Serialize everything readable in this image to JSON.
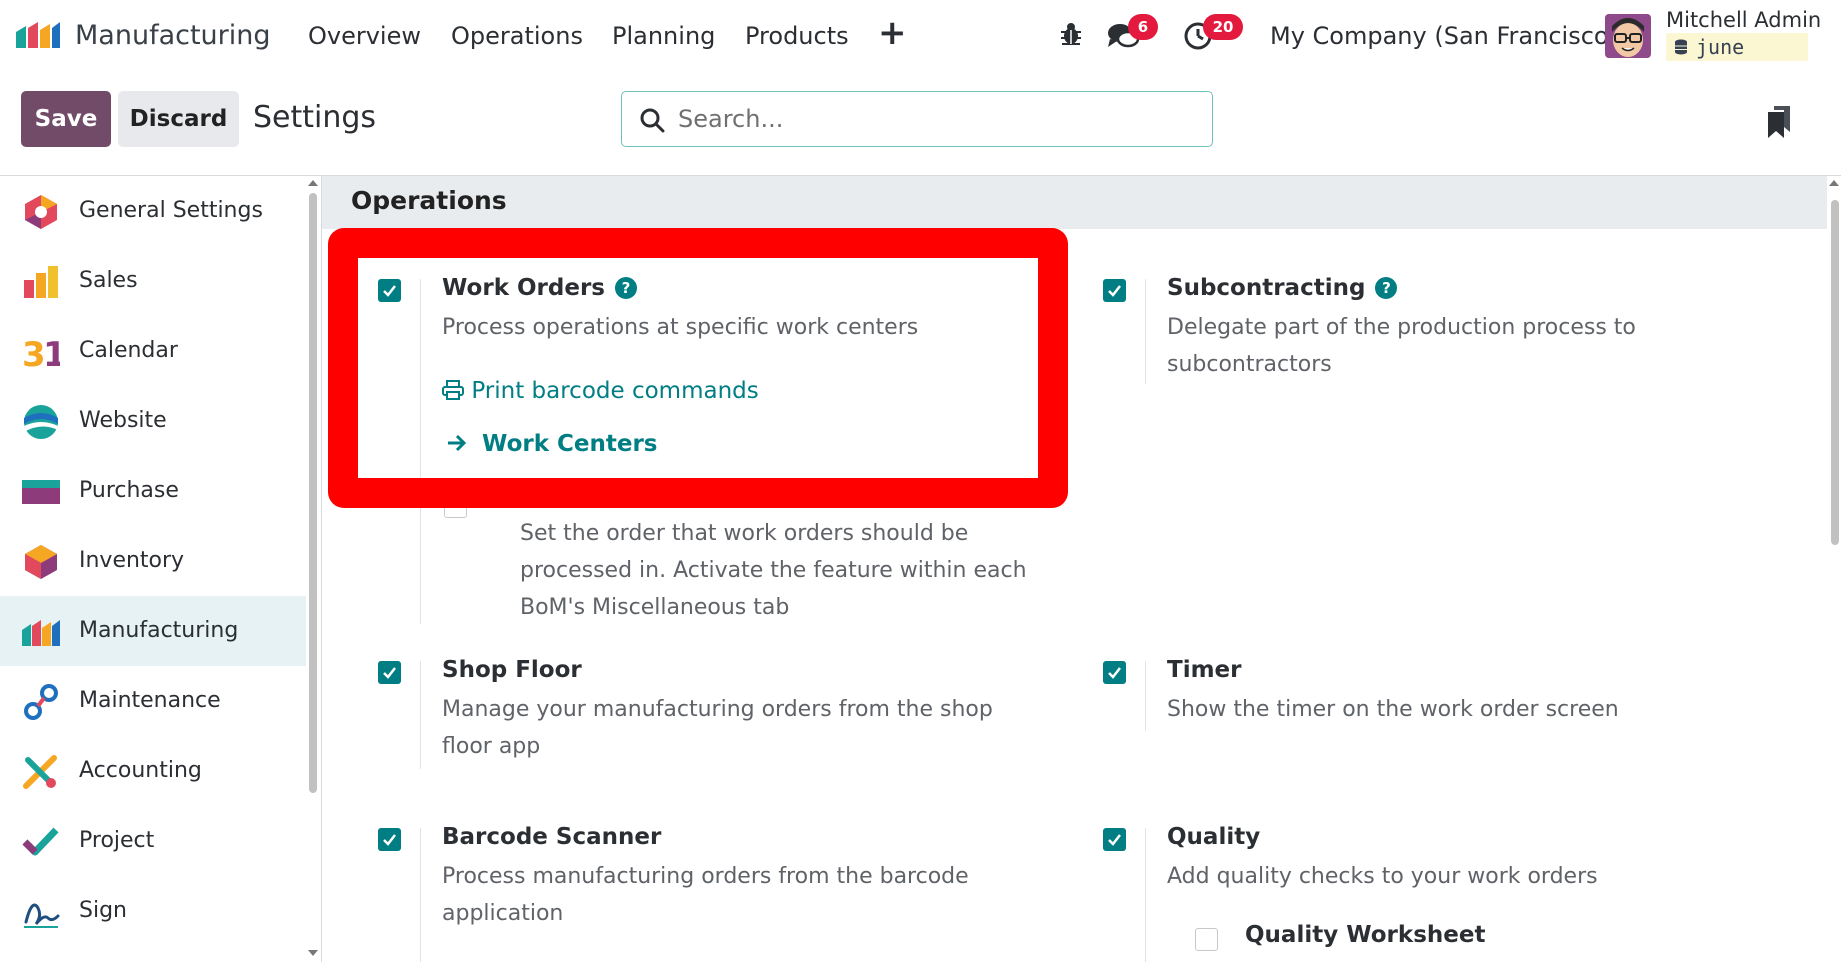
{
  "navbar": {
    "app_name": "Manufacturing",
    "menu": [
      "Overview",
      "Operations",
      "Planning",
      "Products"
    ],
    "messages_count": "6",
    "activities_count": "20",
    "company": "My Company (San Francisco)",
    "user_name": "Mitchell Admin",
    "database": "june"
  },
  "control": {
    "save_label": "Save",
    "discard_label": "Discard",
    "title": "Settings",
    "search_placeholder": "Search..."
  },
  "sidebar": {
    "items": [
      {
        "label": "General Settings",
        "icon": "general-settings-icon"
      },
      {
        "label": "Sales",
        "icon": "sales-icon"
      },
      {
        "label": "Calendar",
        "icon": "calendar-icon"
      },
      {
        "label": "Website",
        "icon": "website-icon"
      },
      {
        "label": "Purchase",
        "icon": "purchase-icon"
      },
      {
        "label": "Inventory",
        "icon": "inventory-icon"
      },
      {
        "label": "Manufacturing",
        "icon": "manufacturing-icon",
        "active": true
      },
      {
        "label": "Maintenance",
        "icon": "maintenance-icon"
      },
      {
        "label": "Accounting",
        "icon": "accounting-icon"
      },
      {
        "label": "Project",
        "icon": "project-icon"
      },
      {
        "label": "Sign",
        "icon": "sign-icon"
      }
    ]
  },
  "section": {
    "title": "Operations",
    "settings": {
      "work_orders": {
        "title": "Work Orders",
        "desc": "Process operations at specific work centers",
        "print_link": "Print barcode commands",
        "work_centers_link": "Work Centers",
        "checked": true
      },
      "work_order_dependencies": {
        "desc": "Set the order that work orders should be processed in. Activate the feature within each BoM's Miscellaneous tab"
      },
      "subcontracting": {
        "title": "Subcontracting",
        "desc": "Delegate part of the production process to subcontractors",
        "checked": true
      },
      "shop_floor": {
        "title": "Shop Floor",
        "desc": "Manage your manufacturing orders from the shop floor app",
        "checked": true
      },
      "timer": {
        "title": "Timer",
        "desc": "Show the timer on the work order screen",
        "checked": true
      },
      "barcode_scanner": {
        "title": "Barcode Scanner",
        "desc": "Process manufacturing orders from the barcode application",
        "checked": true
      },
      "quality": {
        "title": "Quality",
        "desc": "Add quality checks to your work orders",
        "checked": true
      },
      "quality_worksheet": {
        "title": "Quality Worksheet",
        "checked": false
      }
    }
  },
  "colors": {
    "primary": "#714b67",
    "accent": "#017e84",
    "highlight": "#ff0000"
  }
}
